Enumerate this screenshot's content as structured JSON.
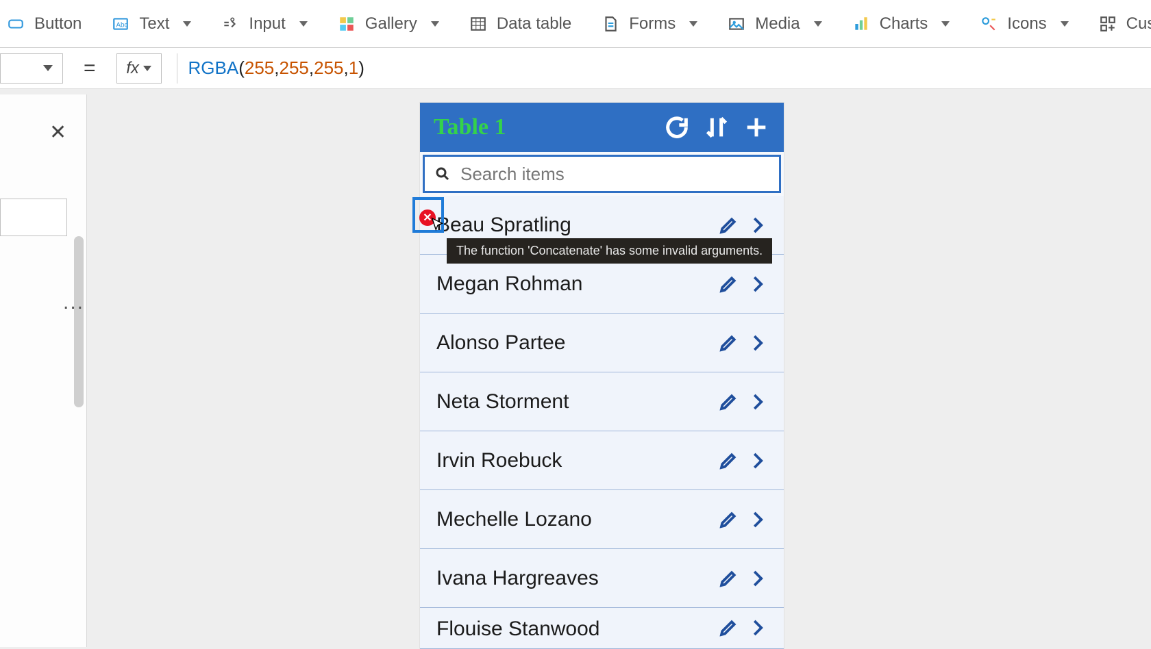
{
  "ribbon": {
    "button": "Button",
    "text": "Text",
    "input": "Input",
    "gallery": "Gallery",
    "datatable": "Data table",
    "forms": "Forms",
    "media": "Media",
    "charts": "Charts",
    "icons": "Icons",
    "custom": "Custo"
  },
  "formula": {
    "fx": "fx",
    "eq": "=",
    "fn": "RGBA",
    "open": "(",
    "a1": "255",
    "c1": ", ",
    "a2": "255",
    "c2": ", ",
    "a3": "255",
    "c3": ", ",
    "a4": "1",
    "close": ")"
  },
  "tree": {
    "close": "✕",
    "dots": "..."
  },
  "app": {
    "title": "Table 1",
    "search_placeholder": "Search items",
    "rows": [
      "Beau Spratling",
      "Megan Rohman",
      "Alonso Partee",
      "Neta Storment",
      "Irvin Roebuck",
      "Mechelle Lozano",
      "Ivana Hargreaves",
      "Flouise Stanwood"
    ]
  },
  "error": {
    "x": "✕",
    "tooltip": "The function 'Concatenate' has some invalid arguments."
  }
}
